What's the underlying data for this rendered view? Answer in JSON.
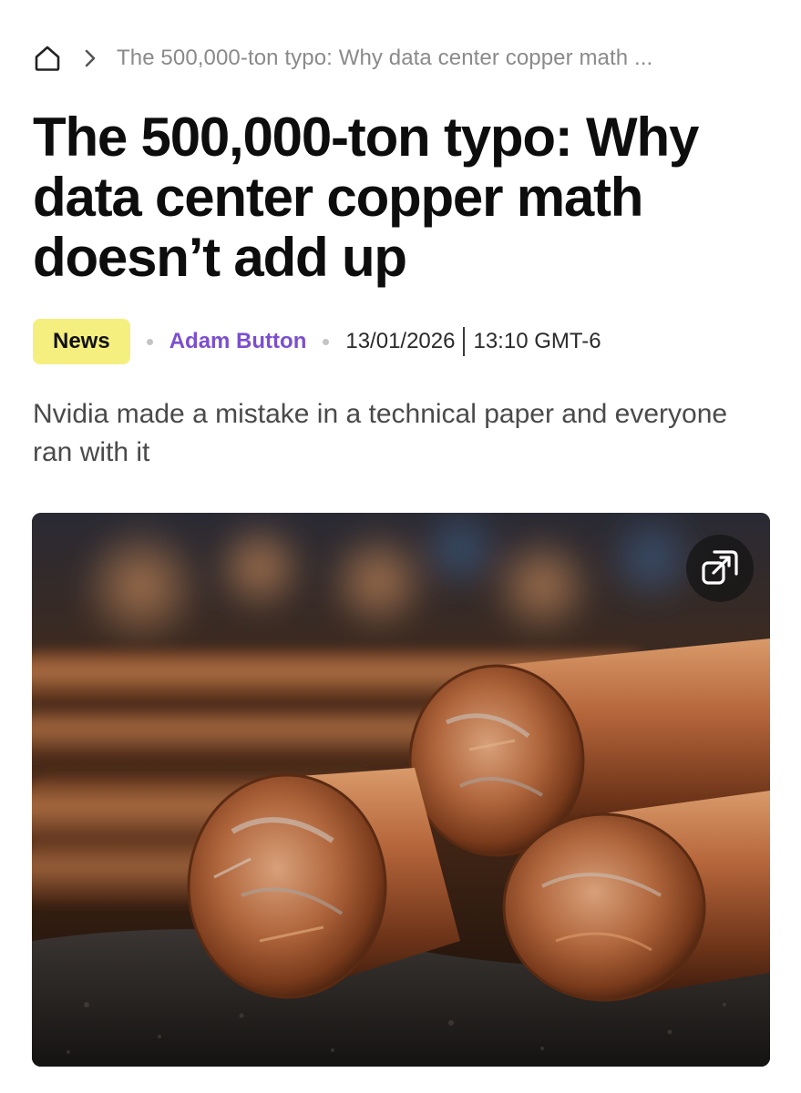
{
  "breadcrumb": {
    "home_icon": "home-icon",
    "separator_icon": "chevron-right-icon",
    "current": "The 500,000-ton typo: Why data center copper math ..."
  },
  "article": {
    "title": "The 500,000-ton typo: Why data center copper math doesn’t add up",
    "category": "News",
    "author": "Adam Button",
    "date": "13/01/2026",
    "time": "13:10 GMT-6",
    "subtitle": "Nvidia made a mistake in a technical paper and everyone ran with it"
  },
  "hero_image": {
    "subject": "copper bars",
    "expand_icon": "expand-icon"
  },
  "colors": {
    "badge_background": "#f5ef7f",
    "author_link": "#7b4fd0",
    "breadcrumb_text": "#8a8a8a",
    "copper": "#b5653a"
  }
}
